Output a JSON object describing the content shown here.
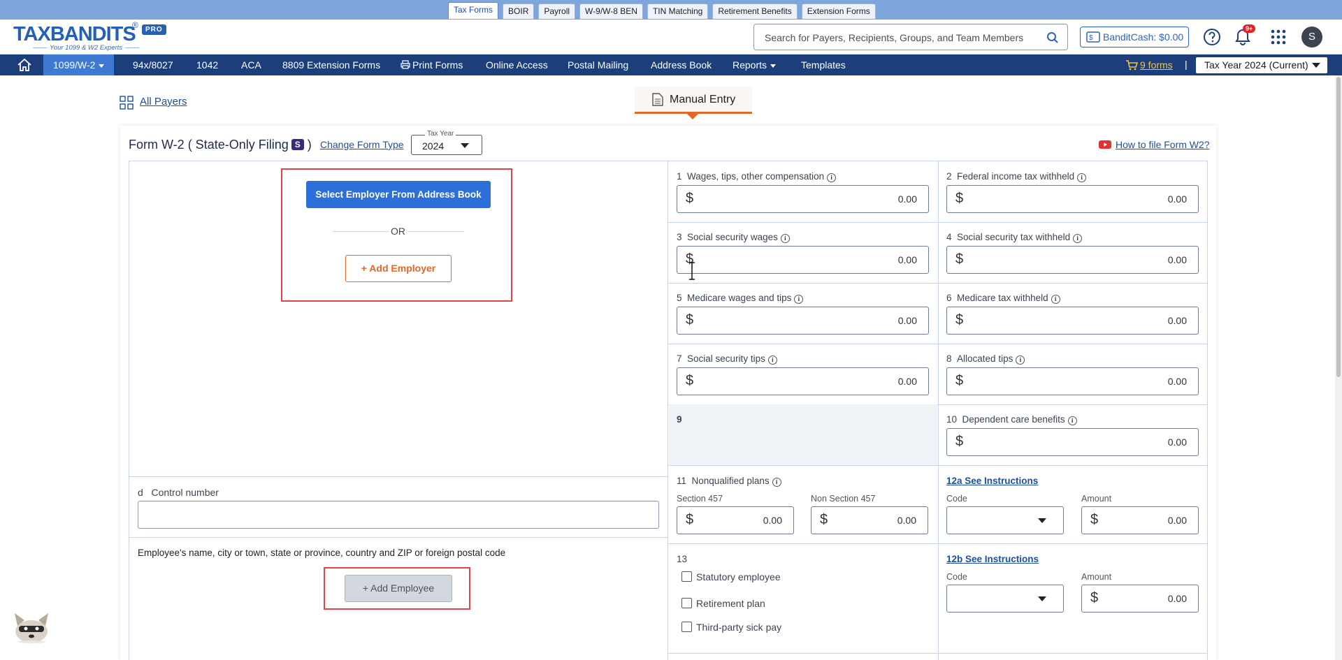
{
  "product_tabs": [
    "Tax Forms",
    "BOIR",
    "Payroll",
    "W-9/W-8 BEN",
    "TIN Matching",
    "Retirement Benefits",
    "Extension Forms"
  ],
  "logo": {
    "text": "TAXBANDITS",
    "registered": "®",
    "badge": "PRO",
    "tagline": "Your 1099 & W2 Experts"
  },
  "header": {
    "search_placeholder": "Search for Payers, Recipients, Groups, and Team Members",
    "bandit_cash": "BanditCash: $0.00",
    "notification_badge": "9+",
    "avatar_initial": "S"
  },
  "nav": {
    "items": [
      "1099/W-2",
      "94x/8027",
      "1042",
      "ACA",
      "8809 Extension Forms",
      "Print Forms",
      "Online Access",
      "Postal Mailing",
      "Address Book",
      "Reports",
      "Templates"
    ],
    "cart": "9 forms",
    "separator": "|",
    "tax_year": "Tax Year 2024 (Current)"
  },
  "subheader": {
    "all_payers": "All Payers",
    "manual_entry": "Manual Entry"
  },
  "form": {
    "title": "Form W-2",
    "subtitle": "( State-Only Filing",
    "badge": "S",
    "subtitle_end": ")",
    "change_type": "Change Form Type",
    "tax_year_label": "Tax Year",
    "tax_year_value": "2024",
    "how_to": "How to file Form W2?"
  },
  "employer": {
    "select_button": "Select Employer From Address Book",
    "or": "OR",
    "add_button": "+ Add Employer"
  },
  "control_number": {
    "letter": "d",
    "label": "Control number",
    "value": ""
  },
  "employee": {
    "label": "Employee's name, city or town, state or province, country and ZIP or foreign postal code",
    "add_button": "+ Add Employee"
  },
  "boxes": {
    "b1": {
      "num": "1",
      "label": "Wages, tips, other compensation",
      "value": "0.00"
    },
    "b2": {
      "num": "2",
      "label": "Federal income tax withheld",
      "value": "0.00"
    },
    "b3": {
      "num": "3",
      "label": "Social security wages",
      "value": "0.00"
    },
    "b4": {
      "num": "4",
      "label": "Social security tax withheld",
      "value": "0.00"
    },
    "b5": {
      "num": "5",
      "label": "Medicare wages and tips",
      "value": "0.00"
    },
    "b6": {
      "num": "6",
      "label": "Medicare tax withheld",
      "value": "0.00"
    },
    "b7": {
      "num": "7",
      "label": "Social security tips",
      "value": "0.00"
    },
    "b8": {
      "num": "8",
      "label": "Allocated tips",
      "value": "0.00"
    },
    "b9": {
      "num": "9"
    },
    "b10": {
      "num": "10",
      "label": "Dependent care benefits",
      "value": "0.00"
    },
    "b11": {
      "num": "11",
      "label": "Nonqualified plans",
      "sec457_label": "Section 457",
      "sec457_value": "0.00",
      "non457_label": "Non Section 457",
      "non457_value": "0.00"
    },
    "b12a": {
      "link": "12a See Instructions",
      "code_label": "Code",
      "amount_label": "Amount",
      "amount": "0.00"
    },
    "b12b": {
      "link": "12b See Instructions",
      "code_label": "Code",
      "amount_label": "Amount",
      "amount": "0.00"
    },
    "b13": {
      "num": "13",
      "statutory": "Statutory employee",
      "retirement": "Retirement plan",
      "sick_pay": "Third-party sick pay"
    }
  },
  "currency_symbol": "$",
  "info_glyph": "i",
  "colors": {
    "nav_bg": "#1c3f7c",
    "nav_active": "#3e7ad4",
    "primary": "#2d6fd8",
    "accent_orange": "#e2682a",
    "highlight_red": "#e04545"
  }
}
